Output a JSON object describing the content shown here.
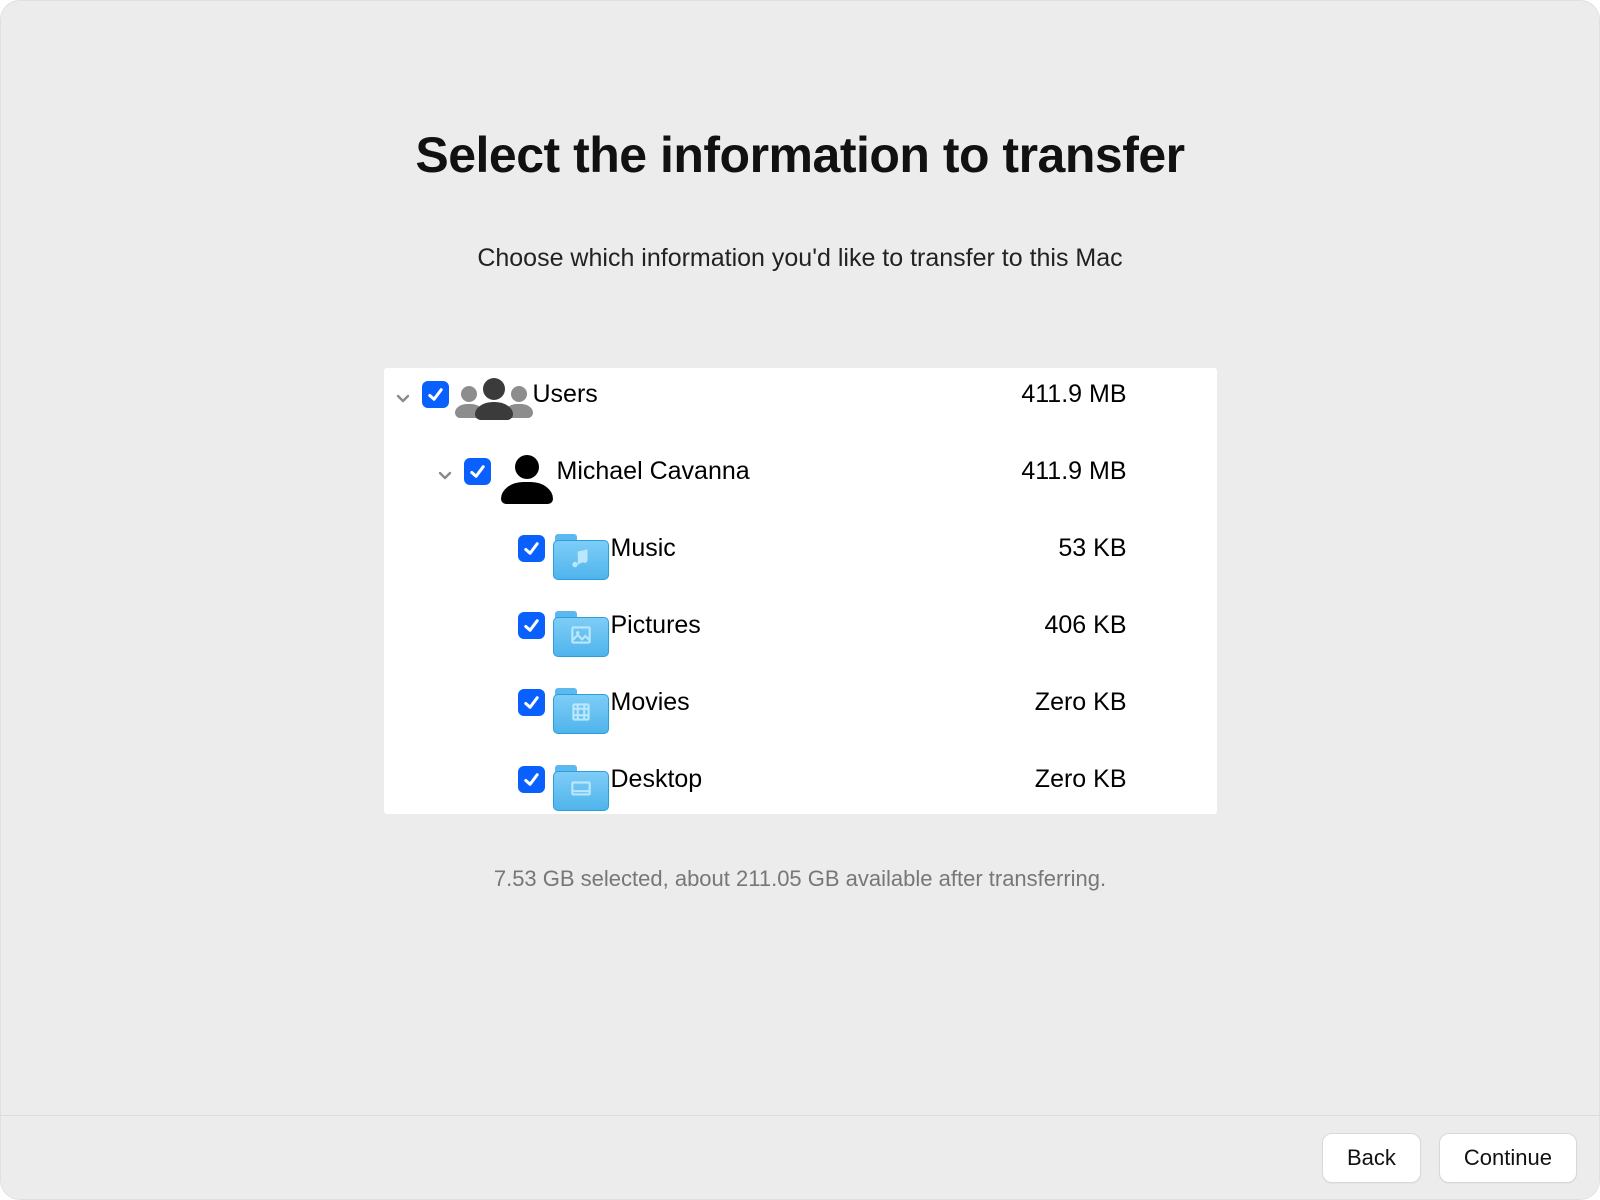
{
  "header": {
    "title": "Select the information to transfer",
    "subtitle": "Choose which information you'd like to transfer to this Mac"
  },
  "tree": {
    "users": {
      "label": "Users",
      "size": "411.9 MB"
    },
    "user": {
      "label": "Michael Cavanna",
      "size": "411.9 MB"
    },
    "music": {
      "label": "Music",
      "size": "53 KB"
    },
    "pictures": {
      "label": "Pictures",
      "size": "406 KB"
    },
    "movies": {
      "label": "Movies",
      "size": "Zero KB"
    },
    "desktop": {
      "label": "Desktop",
      "size": "Zero KB"
    }
  },
  "summary": "7.53 GB selected, about 211.05 GB available after transferring.",
  "footer": {
    "back": "Back",
    "continue": "Continue"
  }
}
